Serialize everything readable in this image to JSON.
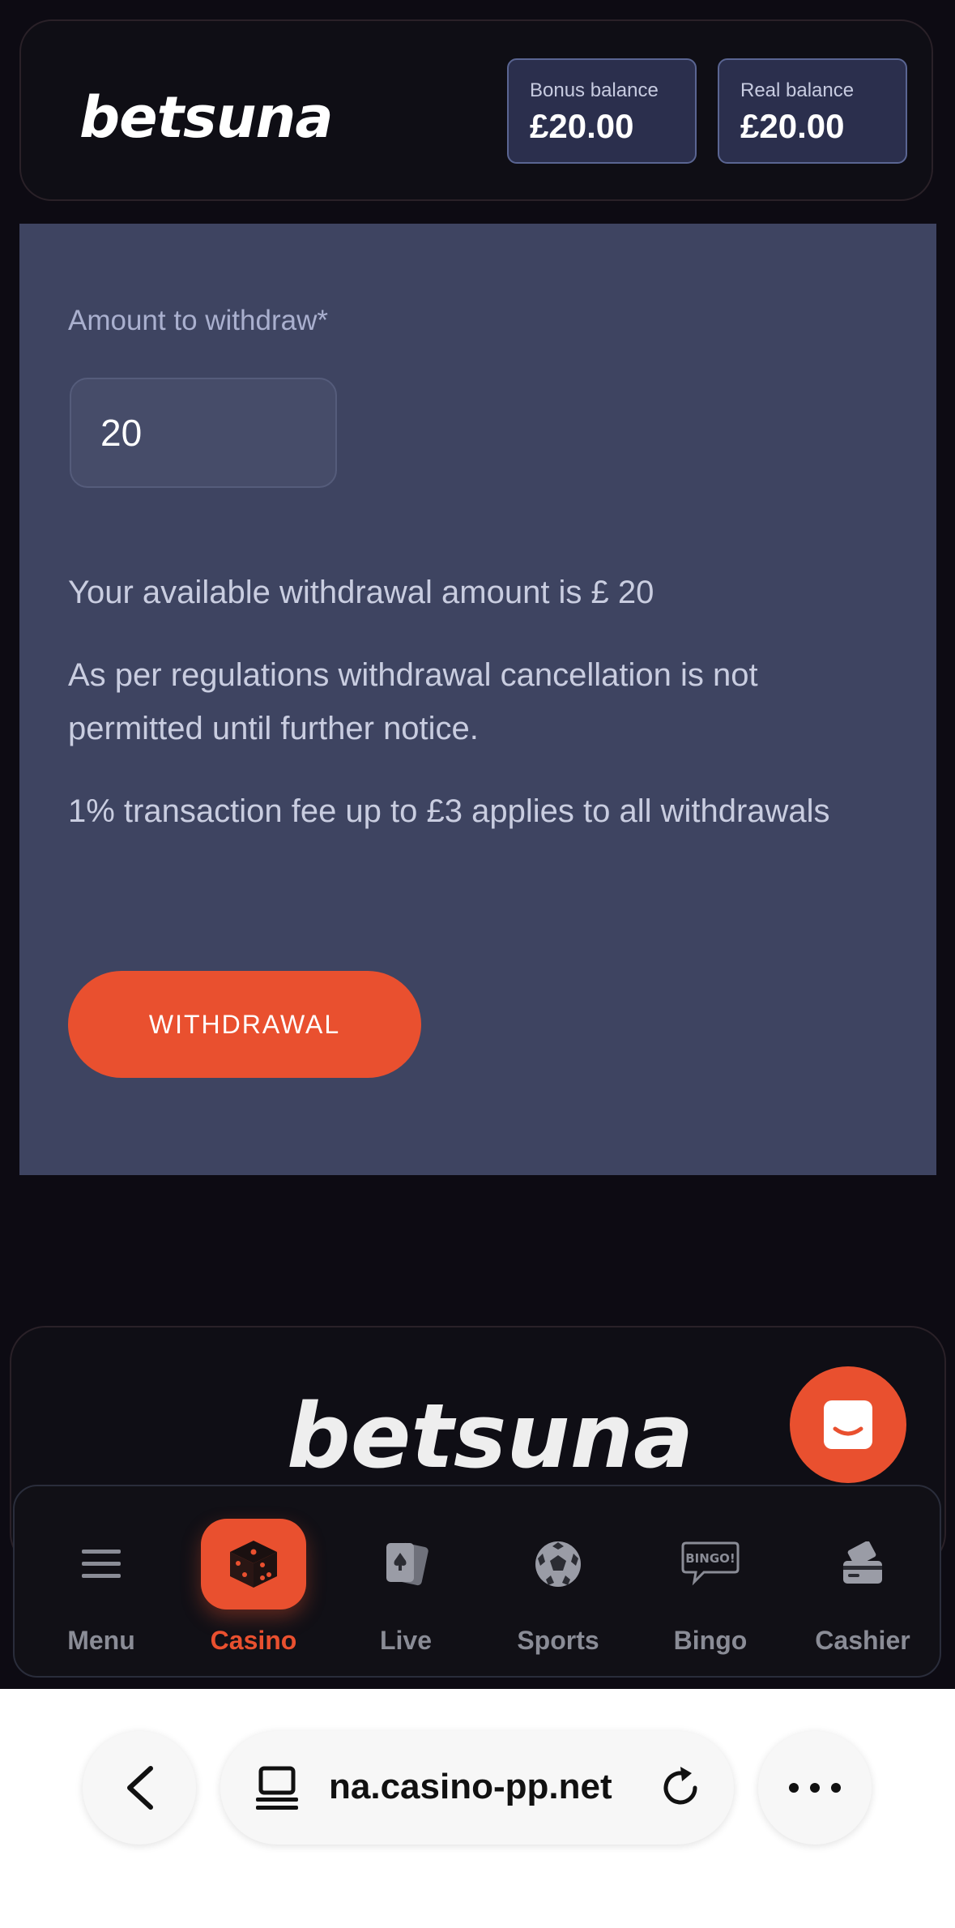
{
  "header": {
    "logo": "betsuna",
    "bonus": {
      "label": "Bonus balance",
      "value": "£20.00"
    },
    "real": {
      "label": "Real balance",
      "value": "£20.00"
    }
  },
  "withdraw": {
    "amount_label": "Amount to withdraw*",
    "amount_value": "20",
    "available_text": "Your available withdrawal amount is £ 20",
    "regulation_text": "As per regulations withdrawal cancellation is not permitted until further notice.",
    "fee_text": "1% transaction fee up to £3 applies to all withdrawals",
    "button_label": "WITHDRAWAL"
  },
  "footer": {
    "logo": "betsuna"
  },
  "nav": {
    "items": [
      {
        "label": "Menu",
        "icon": "menu-icon"
      },
      {
        "label": "Casino",
        "icon": "dice-icon",
        "active": true
      },
      {
        "label": "Live",
        "icon": "cards-icon"
      },
      {
        "label": "Sports",
        "icon": "soccer-ball-icon"
      },
      {
        "label": "Bingo",
        "icon": "bingo-icon",
        "icon_text": "BINGO!"
      },
      {
        "label": "Cashier",
        "icon": "wallet-icon"
      }
    ]
  },
  "browser": {
    "url": "na.casino-pp.net"
  },
  "colors": {
    "accent": "#e9502f",
    "panel": "#3e4461",
    "background": "#0d0b13"
  }
}
